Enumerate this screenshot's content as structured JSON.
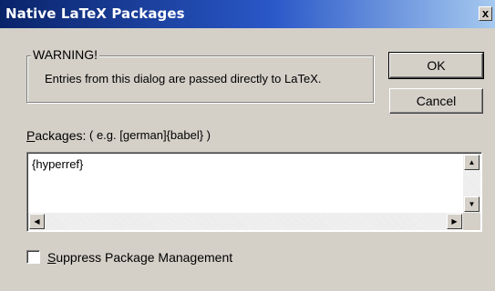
{
  "window": {
    "title": "Native LaTeX Packages",
    "close_glyph": "x"
  },
  "warning": {
    "legend": "WARNING!",
    "text": "Entries from this dialog are passed directly to LaTeX."
  },
  "buttons": {
    "ok": "OK",
    "cancel": "Cancel"
  },
  "packages": {
    "label_mnemonic": "P",
    "label_rest": "ackages:",
    "hint_prefix": "( e.g. [",
    "hint_mnemonic": "g",
    "hint_rest": "erman]{babel} )",
    "value": "{hyperref}"
  },
  "suppress": {
    "label_mnemonic": "S",
    "label_rest": "uppress Package Management",
    "checked": false
  },
  "colors": {
    "title_bar_start": "#0a246a",
    "title_bar_end": "#a6caf0",
    "dialog_face": "#d4d0c8"
  }
}
